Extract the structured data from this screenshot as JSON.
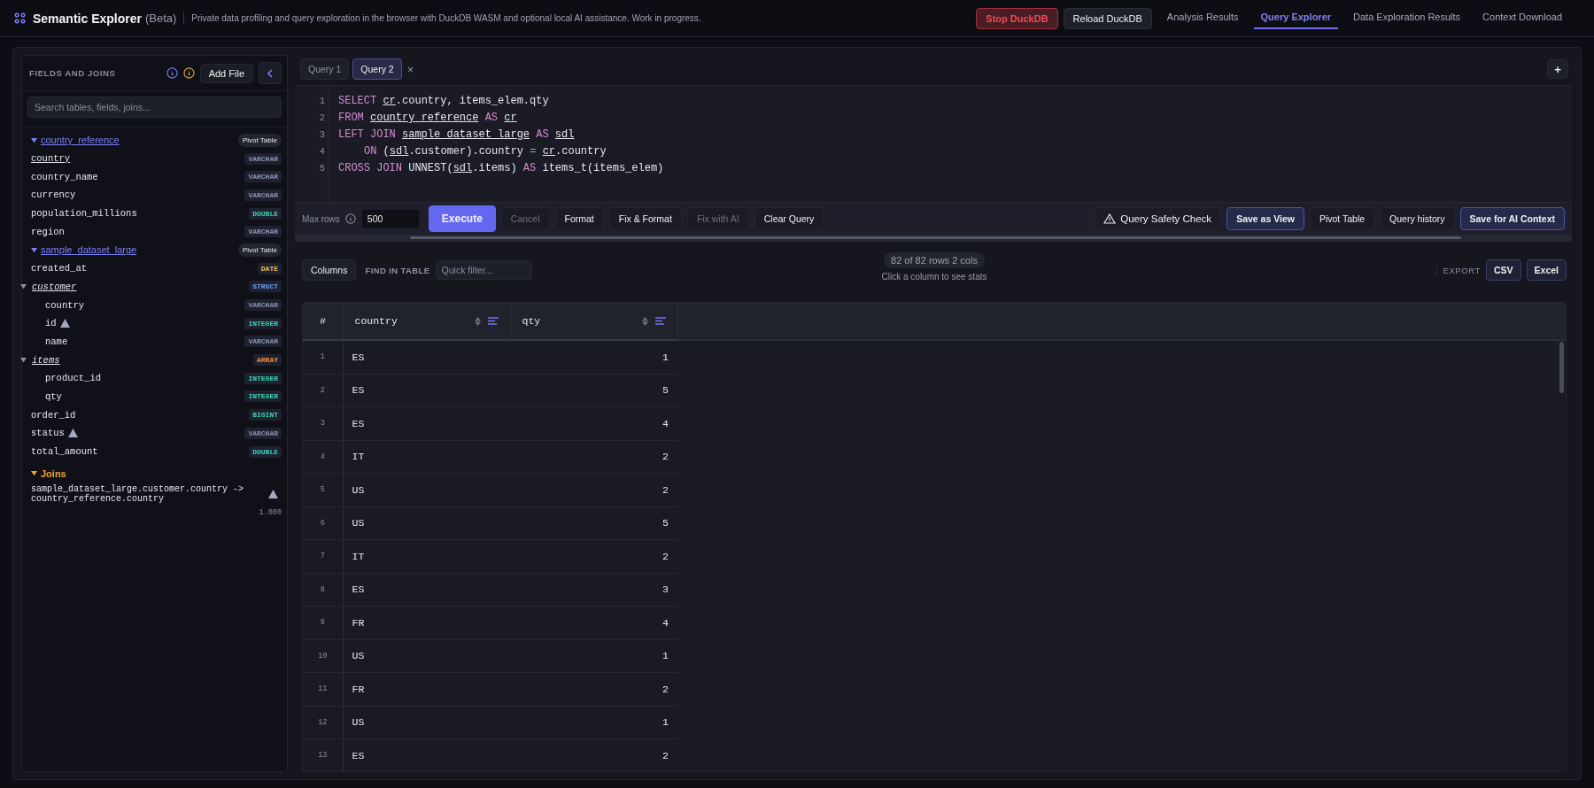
{
  "app": {
    "title": "Semantic Explorer",
    "badge": "(Beta)",
    "tagline": "Private data profiling and query exploration in the browser with DuckDB WASM and optional local AI assistance. Work in progress."
  },
  "header_buttons": [
    {
      "label": "Stop DuckDB",
      "kind": "danger"
    },
    {
      "label": "Reload DuckDB",
      "kind": "plain"
    }
  ],
  "nav_tabs": [
    {
      "label": "Analysis Results",
      "selected": false
    },
    {
      "label": "Query Explorer",
      "selected": true
    },
    {
      "label": "Data Exploration Results",
      "selected": false
    },
    {
      "label": "Context Download",
      "selected": false
    }
  ],
  "sidebar": {
    "title": "FIELDS AND JOINS",
    "add_button": "Add File",
    "search": {
      "placeholder": "Search tables, fields, joins..."
    },
    "tables": [
      {
        "name": "country_reference",
        "expanded": true,
        "action": "Pivot Table",
        "fields": [
          {
            "name": "country",
            "type": "VARCHAR",
            "color": "#8d94a8",
            "kind": "field",
            "join_key": true,
            "warning": false
          },
          {
            "name": "country_name",
            "type": "VARCHAR",
            "color": "#8d94a8",
            "kind": "field",
            "join_key": false,
            "warning": false
          },
          {
            "name": "currency",
            "type": "VARCHAR",
            "color": "#8d94a8",
            "kind": "field",
            "join_key": false,
            "warning": false
          },
          {
            "name": "population_millions",
            "type": "DOUBLE",
            "color": "#3fd1b0",
            "kind": "field",
            "join_key": false,
            "warning": false
          },
          {
            "name": "region",
            "type": "VARCHAR",
            "color": "#8d94a8",
            "kind": "field",
            "join_key": false,
            "warning": false
          }
        ]
      },
      {
        "name": "sample_dataset_large",
        "expanded": true,
        "action": "Pivot Table",
        "fields": [
          {
            "name": "created_at",
            "type": "DATE",
            "color": "#f0c04a",
            "kind": "field",
            "join_key": false,
            "warning": false
          },
          {
            "name": "customer",
            "type": "STRUCT",
            "color": "#6fa0f5",
            "kind": "nested",
            "expanded": true,
            "join_key": false,
            "warning": false,
            "children": [
              {
                "name": "country",
                "type": "VARCHAR",
                "color": "#8d94a8",
                "kind": "field",
                "join_key": false,
                "warning": false
              },
              {
                "name": "id",
                "type": "INTEGER",
                "color": "#3fd1b0",
                "kind": "field",
                "join_key": false,
                "warning": true
              },
              {
                "name": "name",
                "type": "VARCHAR",
                "color": "#8d94a8",
                "kind": "field",
                "join_key": false,
                "warning": false
              }
            ]
          },
          {
            "name": "items",
            "type": "ARRAY",
            "color": "#f28c3e",
            "kind": "nested",
            "expanded": true,
            "join_key": false,
            "warning": false,
            "children": [
              {
                "name": "product_id",
                "type": "INTEGER",
                "color": "#3fd1b0",
                "kind": "field",
                "join_key": false,
                "warning": false
              },
              {
                "name": "qty",
                "type": "INTEGER",
                "color": "#3fd1b0",
                "kind": "field",
                "join_key": false,
                "warning": false
              }
            ]
          },
          {
            "name": "order_id",
            "type": "BIGINT",
            "color": "#3fd1b0",
            "kind": "field",
            "join_key": false,
            "warning": false
          },
          {
            "name": "status",
            "type": "VARCHAR",
            "color": "#8d94a8",
            "kind": "field",
            "join_key": false,
            "warning": true
          },
          {
            "name": "total_amount",
            "type": "DOUBLE",
            "color": "#3fd1b0",
            "kind": "field",
            "join_key": false,
            "warning": false
          }
        ]
      }
    ],
    "joins": {
      "title": "Joins",
      "expanded": true,
      "items": [
        {
          "text": "sample_dataset_large.customer.country -> country_reference.country",
          "score": "1.000",
          "warning": true
        }
      ]
    }
  },
  "editor": {
    "tabs": [
      {
        "label": "Query 1",
        "selected": false
      },
      {
        "label": "Query 2",
        "selected": true
      }
    ],
    "close": "×",
    "add": "+",
    "lines": [
      {
        "number": "1",
        "indent": false,
        "tokens": [
          {
            "text": "SELECT ",
            "kind": "kw"
          },
          {
            "text": "cr",
            "kind": "ref"
          },
          {
            "text": ".country, items_elem.qty",
            "kind": "id"
          }
        ]
      },
      {
        "number": "2",
        "indent": false,
        "tokens": [
          {
            "text": "FROM ",
            "kind": "kw"
          },
          {
            "text": "country_reference",
            "kind": "ref"
          },
          {
            "text": " AS ",
            "kind": "kw"
          },
          {
            "text": "cr",
            "kind": "ref"
          }
        ]
      },
      {
        "number": "3",
        "indent": false,
        "tokens": [
          {
            "text": "LEFT JOIN ",
            "kind": "kw"
          },
          {
            "text": "sample_dataset_large",
            "kind": "ref"
          },
          {
            "text": " AS ",
            "kind": "kw"
          },
          {
            "text": "sdl",
            "kind": "ref"
          }
        ]
      },
      {
        "number": "4",
        "indent": true,
        "tokens": [
          {
            "text": "ON",
            "kind": "kw"
          },
          {
            "text": " (",
            "kind": "id"
          },
          {
            "text": "sdl",
            "kind": "ref"
          },
          {
            "text": ".customer).country ",
            "kind": "id"
          },
          {
            "text": "= ",
            "kind": "op"
          },
          {
            "text": "cr",
            "kind": "ref"
          },
          {
            "text": ".country",
            "kind": "id"
          }
        ]
      },
      {
        "number": "5",
        "indent": false,
        "tokens": [
          {
            "text": "CROSS JOIN ",
            "kind": "kw"
          },
          {
            "text": "UNNEST(",
            "kind": "id"
          },
          {
            "text": "sdl",
            "kind": "ref"
          },
          {
            "text": ".items) ",
            "kind": "id"
          },
          {
            "text": "AS",
            "kind": "kw"
          },
          {
            "text": " items_t(items_elem)",
            "kind": "id"
          }
        ]
      }
    ]
  },
  "toolbar": {
    "max_rows": {
      "label": "Max rows",
      "value": "500"
    },
    "left_buttons": [
      {
        "label": "Execute",
        "kind": "primary",
        "disabled": false
      },
      {
        "label": "Cancel",
        "kind": "plain",
        "disabled": true
      },
      {
        "label": "Format",
        "kind": "plain",
        "disabled": false
      },
      {
        "label": "Fix & Format",
        "kind": "plain",
        "disabled": false
      },
      {
        "label": "Fix with AI",
        "kind": "plain",
        "disabled": true
      },
      {
        "label": "Clear Query",
        "kind": "plain",
        "disabled": false
      }
    ],
    "right_buttons": [
      {
        "label": "Query Safety Check",
        "kind": "check",
        "disabled": false
      },
      {
        "label": "Save as View",
        "kind": "accent",
        "disabled": false
      },
      {
        "label": "Pivot Table",
        "kind": "plain",
        "disabled": false
      },
      {
        "label": "Query history",
        "kind": "plain",
        "disabled": false
      },
      {
        "label": "Save for AI Context",
        "kind": "accent",
        "disabled": false
      }
    ]
  },
  "results": {
    "columns_button": "Columns",
    "find_label": "FIND IN TABLE",
    "filter": {
      "placeholder": "Quick filter..."
    },
    "summary": "82 of 82 rows 2 cols",
    "hint": "Click a column to see stats",
    "export_label": "EXPORT",
    "export_buttons": [
      "CSV",
      "Excel"
    ],
    "table": {
      "columns": [
        "#",
        "country",
        "qty"
      ],
      "rows": [
        [
          "1",
          "ES",
          "1"
        ],
        [
          "2",
          "ES",
          "5"
        ],
        [
          "3",
          "ES",
          "4"
        ],
        [
          "4",
          "IT",
          "2"
        ],
        [
          "5",
          "US",
          "2"
        ],
        [
          "6",
          "US",
          "5"
        ],
        [
          "7",
          "IT",
          "2"
        ],
        [
          "8",
          "ES",
          "3"
        ],
        [
          "9",
          "FR",
          "4"
        ],
        [
          "10",
          "US",
          "1"
        ],
        [
          "11",
          "FR",
          "2"
        ],
        [
          "12",
          "US",
          "1"
        ],
        [
          "13",
          "ES",
          "2"
        ]
      ]
    }
  }
}
